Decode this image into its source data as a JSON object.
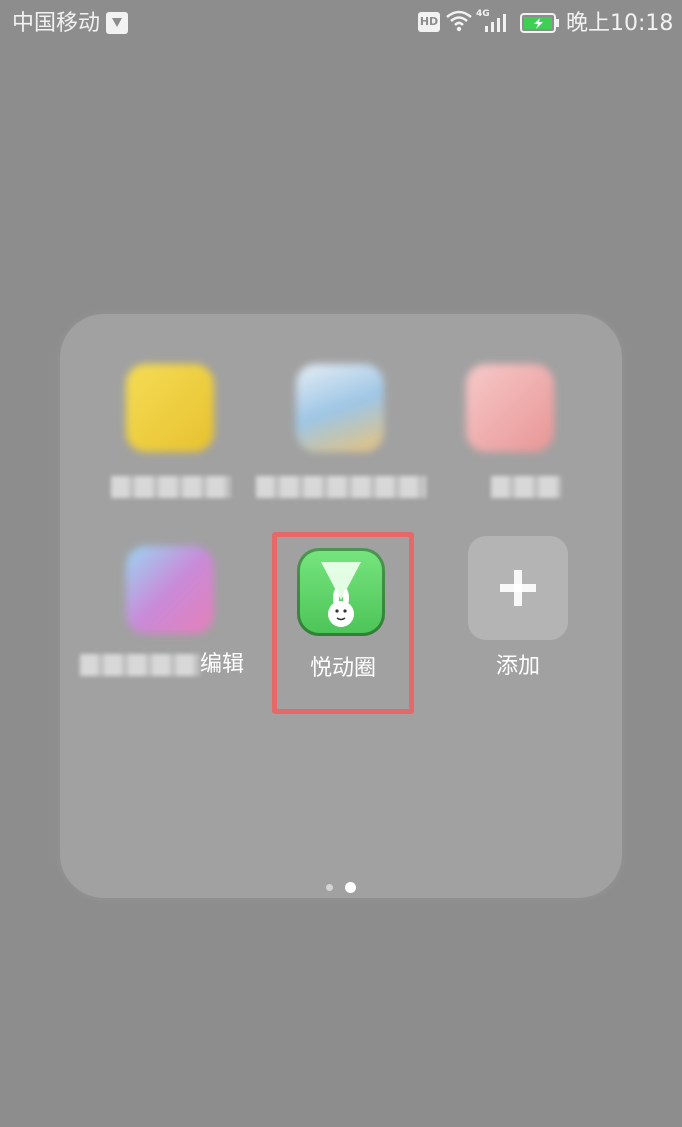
{
  "status_bar": {
    "carrier": "中国移动",
    "hd_badge": "HD",
    "network": "4G",
    "time": "晚上10:18",
    "icons": [
      "sim-icon",
      "hd-badge",
      "wifi-icon",
      "signal-icon",
      "battery-charging-icon"
    ]
  },
  "folder": {
    "title": "",
    "apps": [
      {
        "label": "",
        "icon": "yellow-app-icon",
        "color": "#f0d245"
      },
      {
        "label": "",
        "icon": "blue-app-icon",
        "color": "#9ec6e6"
      },
      {
        "label": "",
        "icon": "red-app-icon",
        "color": "#f1a8a8"
      },
      {
        "label": "编辑",
        "icon": "purple-app-icon",
        "color": "#c98ad8"
      },
      {
        "label": "悦动圈",
        "icon": "yuedong-icon",
        "color": "#5dd06a"
      },
      {
        "label": "添加",
        "icon": "add-icon",
        "color": "#b4b4b4"
      }
    ],
    "page_count": 2,
    "current_page": 2
  },
  "colors": {
    "highlight": "#e56969",
    "background": "#8d8d8d",
    "panel": "#a1a1a1"
  }
}
